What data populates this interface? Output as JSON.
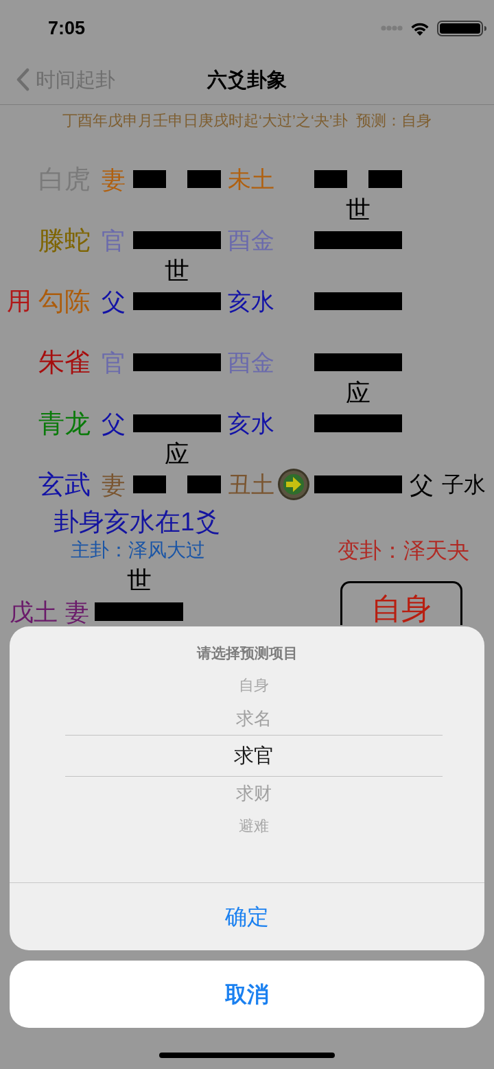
{
  "status_bar": {
    "time": "7:05"
  },
  "nav_bar": {
    "back_label": "时间起卦",
    "title": "六爻卦象"
  },
  "summary": "丁酉年戊申月壬申日庚戌时起‘大过’之‘夬’卦  预测：自身",
  "yao_rows": [
    {
      "beast": {
        "text": "白虎",
        "color": "#7a7a7a"
      },
      "relative": {
        "text": "妻",
        "color": "#b0600f"
      },
      "main_line": {
        "kind": "yin"
      },
      "branch": {
        "text": "未土",
        "color": "#b0600f"
      },
      "moving": false,
      "changed_line": {
        "kind": "yin"
      }
    },
    {
      "right_mark": "世",
      "beast": {
        "text": "滕蛇",
        "color": "#7e6400"
      },
      "relative": {
        "text": "官",
        "color": "#6a6aac"
      },
      "main_line": {
        "kind": "yang"
      },
      "branch": {
        "text": "酉金",
        "color": "#6a6aac"
      },
      "moving": false,
      "changed_line": {
        "kind": "yang"
      }
    },
    {
      "left_mark": "世",
      "use_label": "用",
      "beast": {
        "text": "勾陈",
        "color": "#ac5c0c"
      },
      "relative": {
        "text": "父",
        "color": "#1212a6"
      },
      "main_line": {
        "kind": "yang"
      },
      "branch": {
        "text": "亥水",
        "color": "#1212a6"
      },
      "moving": false,
      "changed_line": {
        "kind": "yang"
      }
    },
    {
      "beast": {
        "text": "朱雀",
        "color": "#a60e0e"
      },
      "relative": {
        "text": "官",
        "color": "#6a6aac"
      },
      "main_line": {
        "kind": "yang"
      },
      "branch": {
        "text": "酉金",
        "color": "#6a6aac"
      },
      "moving": false,
      "changed_line": {
        "kind": "yang"
      }
    },
    {
      "right_mark": "应",
      "beast": {
        "text": "青龙",
        "color": "#0a7a0a"
      },
      "relative": {
        "text": "父",
        "color": "#1212a6"
      },
      "main_line": {
        "kind": "yang"
      },
      "branch": {
        "text": "亥水",
        "color": "#1212a6"
      },
      "moving": false,
      "changed_line": {
        "kind": "yang"
      }
    },
    {
      "left_mark": "应",
      "beast": {
        "text": "玄武",
        "color": "#1212a6"
      },
      "relative": {
        "text": "妻",
        "color": "#7a5530"
      },
      "main_line": {
        "kind": "yin"
      },
      "branch": {
        "text": "丑土",
        "color": "#7a5530"
      },
      "moving": true,
      "changed_line": {
        "kind": "yang"
      },
      "changed_relative": "父",
      "changed_branch": "子水"
    }
  ],
  "body_note": "卦身亥水在1爻",
  "main_hexagram": "主卦：泽风大过",
  "changed_hexagram": "变卦：泽天夬",
  "hidden_yao": {
    "mark": "世",
    "branch": "戊土",
    "relative": "妻",
    "line": {
      "kind": "yang"
    }
  },
  "project_button": "自身",
  "picker_sheet": {
    "title": "请选择预测项目",
    "options": [
      {
        "label": "自身",
        "selected": false
      },
      {
        "label": "求名",
        "selected": false
      },
      {
        "label": "求官",
        "selected": true
      },
      {
        "label": "求财",
        "selected": false
      },
      {
        "label": "避难",
        "selected": false
      }
    ],
    "confirm": "确定"
  },
  "cancel": "取消"
}
